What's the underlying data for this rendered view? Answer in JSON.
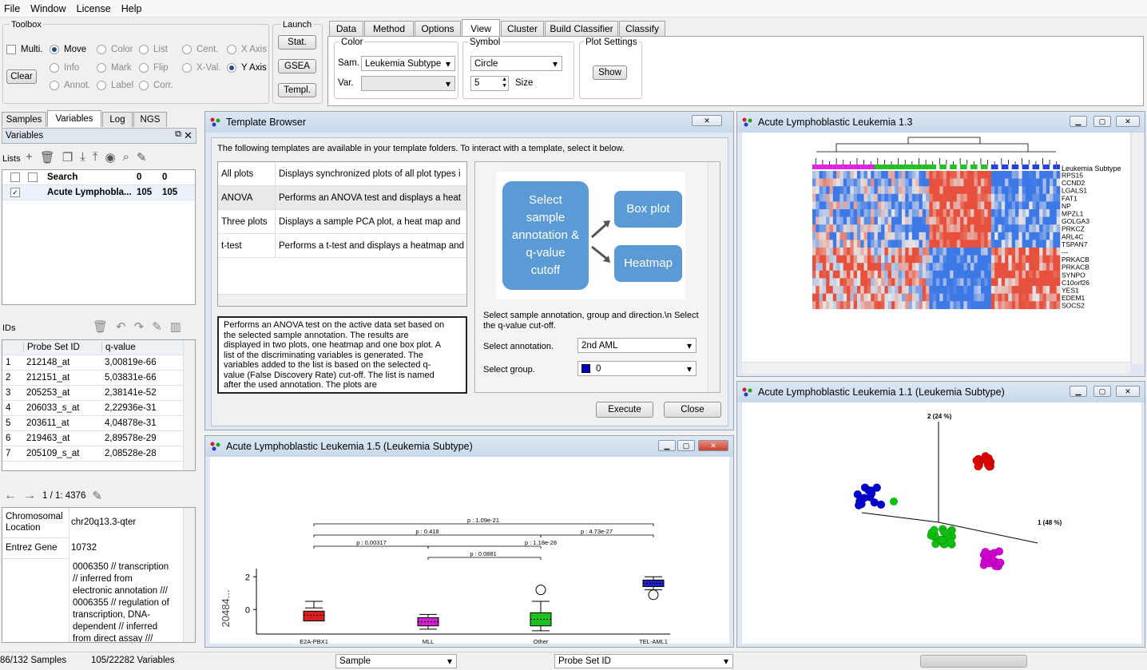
{
  "menu": [
    "File",
    "Window",
    "License",
    "Help"
  ],
  "toolbox": {
    "title": "Toolbox",
    "multi": "Multi.",
    "clear": "Clear",
    "radios": [
      [
        "Move",
        "Color",
        "List",
        "Cent.",
        "X Axis"
      ],
      [
        "Info",
        "Mark",
        "Flip",
        "X-Val.",
        "Y Axis"
      ],
      [
        "Annot.",
        "Label",
        "Corr."
      ]
    ]
  },
  "launch": {
    "title": "Launch",
    "stat": "Stat.",
    "gsea": "GSEA",
    "templ": "Templ."
  },
  "tabs": [
    "Data",
    "Method",
    "Options",
    "View",
    "Cluster",
    "Build Classifier",
    "Classify"
  ],
  "view": {
    "color_label": "Color",
    "sam_label": "Sam.",
    "sam_value": "Leukemia Subtype",
    "var_label": "Var.",
    "symbol_label": "Symbol",
    "symbol_value": "Circle",
    "size_value": "5",
    "size_label": "Size",
    "plot_settings": "Plot Settings",
    "show": "Show"
  },
  "side_tabs": [
    "Samples",
    "Variables",
    "Log",
    "NGS"
  ],
  "variables": {
    "header": "Variables",
    "lists_label": "Lists",
    "lists": [
      {
        "name": "Search",
        "a": "0",
        "b": "0",
        "checked": false
      },
      {
        "name": "Acute Lymphobla...",
        "a": "105",
        "b": "105",
        "checked": true
      }
    ],
    "ids_label": "IDs",
    "col_probe": "Probe Set ID",
    "col_q": "q-value",
    "rows": [
      [
        "1",
        "212148_at",
        "3,00819e-66"
      ],
      [
        "2",
        "212151_at",
        "5,03831e-66"
      ],
      [
        "3",
        "205253_at",
        "2,38141e-52"
      ],
      [
        "4",
        "206033_s_at",
        "2,22936e-31"
      ],
      [
        "5",
        "203611_at",
        "4,04878e-31"
      ],
      [
        "6",
        "219463_at",
        "2,89578e-29"
      ],
      [
        "7",
        "205109_s_at",
        "2,08528e-28"
      ]
    ]
  },
  "info": {
    "nav": "1 / 1: 4376",
    "chrom_label": "Chromosomal Location",
    "chrom_value": "chr20q13.3-qter",
    "entrez_label": "Entrez Gene",
    "entrez_value": "10732",
    "go_lines": [
      "0006350 // transcription",
      "// inferred from",
      "electronic annotation ///",
      "0006355 // regulation of",
      "transcription, DNA-",
      "dependent // inferred",
      "from direct assay ///"
    ]
  },
  "template_browser": {
    "title": "Template Browser",
    "intro": "The following templates are available in your template folders. To interact with a template, select it below.",
    "templates": [
      [
        "All plots",
        "Displays synchronized plots of all plot types i"
      ],
      [
        "ANOVA",
        "Performs an ANOVA test and displays a heat"
      ],
      [
        "Three plots",
        "Displays a sample PCA plot, a heat map and"
      ],
      [
        "t-test",
        "Performs a t-test and displays a heatmap and"
      ]
    ],
    "description": "Performs an ANOVA test on the active data set based on the selected sample annotation. The results are displayed in two plots, one heatmap and one box plot. A list of the discriminating variables is generated. The variables added to the list is based on the selected q-value (False Discovery Rate) cut-off. The list is named after the used annotation. The plots are",
    "flow_start": "Select sample annotation & q-value cutoff",
    "flow_box": "Box plot",
    "flow_heat": "Heatmap",
    "instructions": "Select sample annotation, group and direction.\\n Select the q-value cut-off.",
    "annot_label": "Select annotation.",
    "annot_value": "2nd AML",
    "group_label": "Select group.",
    "group_value": "0",
    "execute": "Execute",
    "close": "Close"
  },
  "heatmap_win": {
    "title": "Acute Lymphoblastic Leukemia 1.3",
    "legend": "Leukemia Subtype",
    "genes": [
      "RPS15",
      "CCND2",
      "LGALS1",
      "FAT1",
      "NP",
      "MPZL1",
      "GOLGA3",
      "PRKCZ",
      "ARL4C",
      "TSPAN7",
      "---",
      "PRKACB",
      "PRKACB",
      "SYNPO",
      "C10orf26",
      "YES1",
      "EDEM1",
      "SOCS2"
    ]
  },
  "pca_win": {
    "title": "Acute Lymphoblastic Leukemia 1.1 (Leukemia Subtype)",
    "axis1": "1 (48 %)",
    "axis2": "2 (24 %)"
  },
  "box_win": {
    "title": "Acute Lymphoblastic Leukemia 1.5 (Leukemia Subtype)"
  },
  "chart_data": {
    "type": "box",
    "xlabel": "Leukemia Subtype",
    "ylabel": "20484...",
    "categories": [
      "E2A-PBX1",
      "MLL",
      "Other",
      "TEL-AML1"
    ],
    "colors": [
      "#d82020",
      "#d020d0",
      "#20c020",
      "#2020c0"
    ],
    "boxes": [
      {
        "min": 0.1,
        "q1": -0.7,
        "median": -0.35,
        "q3": -0.1,
        "max": 0.5,
        "low": -0.9
      },
      {
        "min": -1.2,
        "q1": -1.0,
        "median": -0.75,
        "q3": -0.5,
        "max": -0.3
      },
      {
        "min": -1.3,
        "q1": -1.0,
        "median": -0.6,
        "q3": -0.2,
        "max": 0.5,
        "outlier": 1.2
      },
      {
        "min": 1.2,
        "q1": 1.4,
        "median": 1.6,
        "q3": 1.8,
        "max": 2.0,
        "outlier": 0.9
      }
    ],
    "yticks": [
      0,
      2
    ],
    "ylim": [
      -1.5,
      2.5
    ],
    "pvalues": [
      {
        "label": "p : 1.09e-21"
      },
      {
        "label": "p : 0.418"
      },
      {
        "label": "p : 4.73e-27"
      },
      {
        "label": "p : 0.00317"
      },
      {
        "label": "p : 1.18e-28"
      },
      {
        "label": "p : 0.0881"
      }
    ]
  },
  "status": {
    "samples": "86/132 Samples",
    "variables": "105/22282 Variables",
    "sample_sel": "Sample",
    "probe_sel": "Probe Set ID"
  }
}
